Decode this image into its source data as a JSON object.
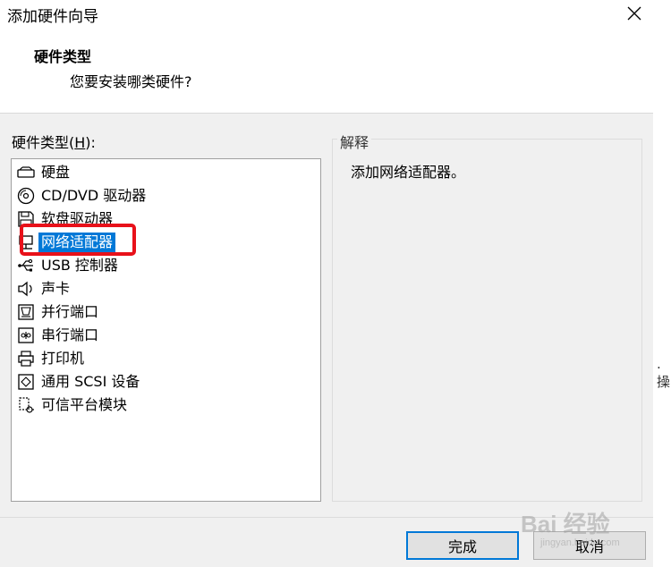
{
  "window": {
    "title": "添加硬件向导"
  },
  "header": {
    "title": "硬件类型",
    "subtitle": "您要安装哪类硬件?"
  },
  "list": {
    "label_prefix": "硬件类型(",
    "label_key": "H",
    "label_suffix": "):",
    "items": [
      {
        "label": "硬盘",
        "icon": "hard-disk-icon"
      },
      {
        "label": "CD/DVD 驱动器",
        "icon": "cd-dvd-icon"
      },
      {
        "label": "软盘驱动器",
        "icon": "floppy-disk-icon"
      },
      {
        "label": "网络适配器",
        "icon": "network-adapter-icon",
        "selected": true
      },
      {
        "label": "USB 控制器",
        "icon": "usb-icon"
      },
      {
        "label": "声卡",
        "icon": "speaker-icon"
      },
      {
        "label": "并行端口",
        "icon": "parallel-port-icon"
      },
      {
        "label": "串行端口",
        "icon": "serial-port-icon"
      },
      {
        "label": "打印机",
        "icon": "printer-icon"
      },
      {
        "label": "通用 SCSI 设备",
        "icon": "scsi-device-icon"
      },
      {
        "label": "可信平台模块",
        "icon": "tpm-icon"
      }
    ]
  },
  "explanation": {
    "title": "解释",
    "text": "添加网络适配器。"
  },
  "buttons": {
    "finish": "完成",
    "cancel": "取消"
  },
  "right_edge_text": ".操",
  "watermark": {
    "main": "Bai 经验",
    "sub": "jingyan.baidu.com"
  },
  "colors": {
    "selection": "#0078d7",
    "annotation_box": "#e8111a"
  }
}
